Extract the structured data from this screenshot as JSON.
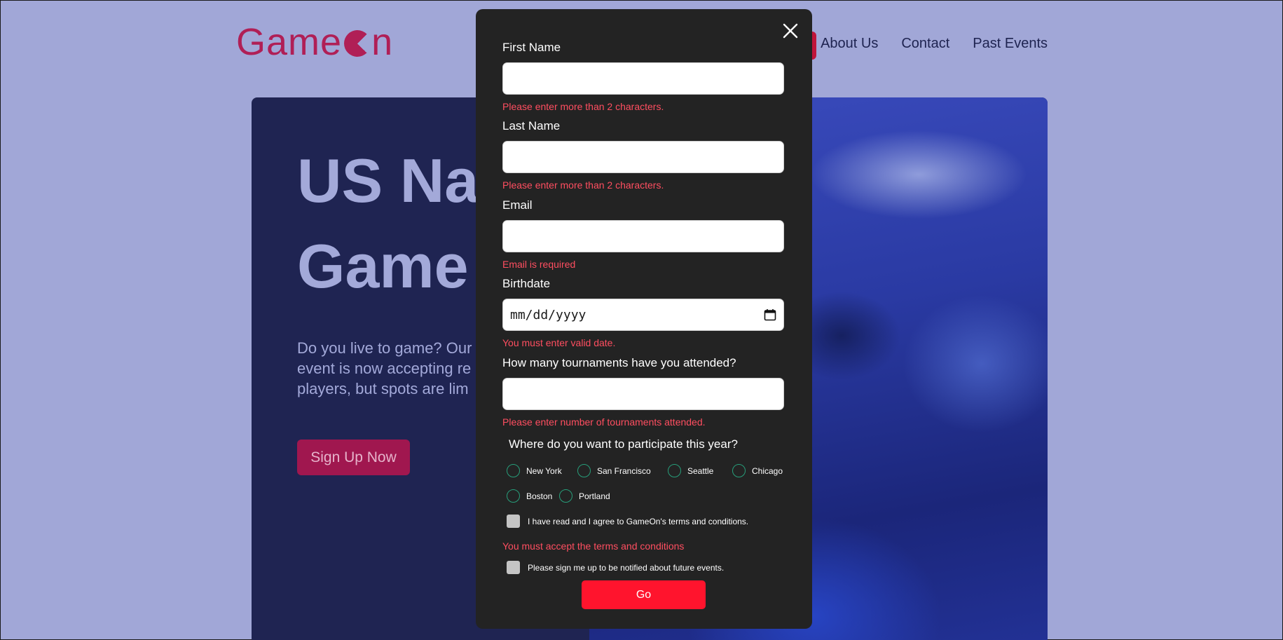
{
  "logo": {
    "text_before": "Game",
    "text_after": "n"
  },
  "nav": {
    "about": "About Us",
    "contact": "Contact",
    "past_events": "Past Events"
  },
  "hero": {
    "title_line1": "US Nat",
    "title_line2": "Game",
    "text_line1": "Do you live to game? Our",
    "text_line2": "event is now accepting re",
    "text_line3": "players, but spots are lim",
    "signup_label": "Sign Up Now"
  },
  "form": {
    "first_name": {
      "label": "First Name",
      "value": "",
      "error": "Please enter more than 2 characters."
    },
    "last_name": {
      "label": "Last Name",
      "value": "",
      "error": "Please enter more than 2 characters."
    },
    "email": {
      "label": "Email",
      "value": "",
      "error": "Email is required"
    },
    "birthdate": {
      "label": "Birthdate",
      "placeholder": "mm/dd/yyyy",
      "error": "You must enter valid date."
    },
    "tournaments": {
      "label": "How many tournaments have you attended?",
      "value": "",
      "error": "Please enter number of tournaments attended."
    },
    "location_question": "Where do you want to participate this year?",
    "locations": [
      "New York",
      "San Francisco",
      "Seattle",
      "Chicago",
      "Boston",
      "Portland"
    ],
    "terms_label": "I have read and I agree to GameOn's terms and conditions.",
    "terms_error": "You must accept the terms and conditions",
    "notify_label": "Please sign me up to be notified about future events.",
    "submit_label": "Go"
  },
  "colors": {
    "page_bg": "#a1a7d7",
    "brand": "#b01f56",
    "modal_bg": "#232323",
    "error": "#ff4e60",
    "radio_ring": "#279e7a",
    "submit": "#ff142d"
  },
  "icons": {
    "close": "close-icon",
    "calendar": "calendar-icon"
  }
}
